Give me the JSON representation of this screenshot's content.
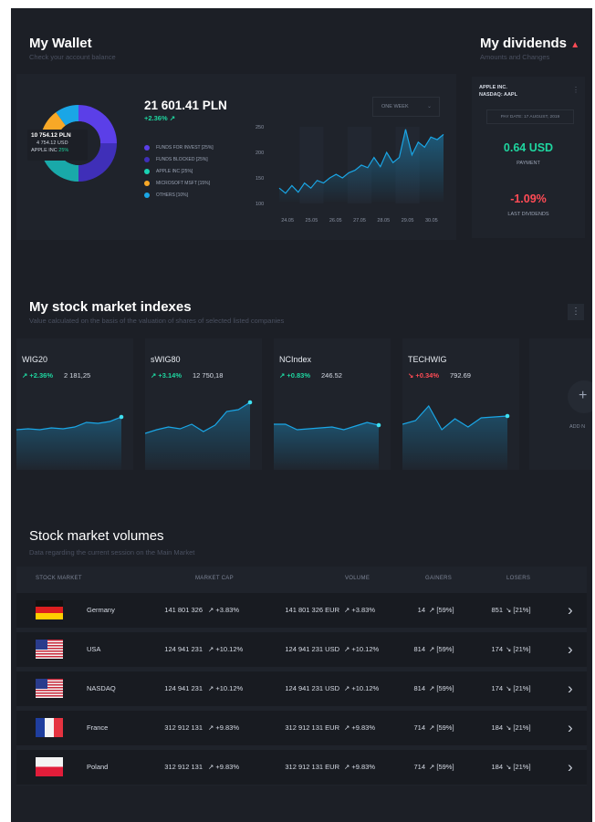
{
  "wallet": {
    "title": "My Wallet",
    "subtitle": "Check your account balance",
    "balance": "21 601.41 PLN",
    "change": "+2.36% ↗",
    "donut_center": {
      "line1": "10 754.12 PLN",
      "line2": "4 754.12 USD",
      "line3": "APPLE INC",
      "line3_pct": "25%"
    },
    "legend": [
      {
        "label": "FUNDS FOR INVEST [25%]",
        "color": "#5b3fe8"
      },
      {
        "label": "FUNDS BLOCKED [25%]",
        "color": "#3f2fb8"
      },
      {
        "label": "APPLE INC [25%]",
        "color": "#19d3b4"
      },
      {
        "label": "MICROSOFT MSFT [15%]",
        "color": "#f7a827"
      },
      {
        "label": "OTHERS [10%]",
        "color": "#1aa6e6"
      }
    ],
    "donut_segments": [
      {
        "name": "funds-for-invest",
        "value": 25,
        "color": "#5b3fe8"
      },
      {
        "name": "funds-blocked",
        "value": 25,
        "color": "#3f2fb8"
      },
      {
        "name": "apple",
        "value": 25,
        "color": "#19a9a9"
      },
      {
        "name": "microsoft",
        "value": 15,
        "color": "#f7a827"
      },
      {
        "name": "others",
        "value": 10,
        "color": "#1aa6e6"
      }
    ],
    "period": "ONE WEEK",
    "chart_data": {
      "type": "area",
      "x": [
        "24.05",
        "25.05",
        "26.05",
        "27.05",
        "28.05",
        "29.05",
        "30.05"
      ],
      "y_ticks": [
        100,
        150,
        200,
        250
      ],
      "ylim": [
        100,
        250
      ],
      "values": [
        130,
        120,
        135,
        122,
        140,
        130,
        145,
        140,
        150,
        157,
        150,
        160,
        165,
        175,
        170,
        190,
        172,
        200,
        180,
        190,
        245,
        195,
        220,
        210,
        230,
        225,
        235
      ]
    }
  },
  "dividends": {
    "title": "My dividends",
    "subtitle": "Amounts and Changes",
    "company": "APPLE INC.",
    "ticker": "NASDAQ: AAPL",
    "pay_date": "PAY DATE: 17 AUGUST, 2019",
    "payment_value": "0.64 USD",
    "payment_label": "PAYMENT",
    "last_value": "-1.09%",
    "last_label": "LAST DIVIDENDS"
  },
  "indexes": {
    "title": "My stock market indexes",
    "subtitle": "Value calculated on the basis of the valuation of shares of selected listed companies",
    "add_label": "ADD N",
    "cards": [
      {
        "name": "WIG20",
        "change": "↗ +2.36%",
        "direction": "up",
        "value": "2 181,25",
        "points": [
          50,
          49,
          50,
          48,
          49,
          47,
          42,
          43,
          41,
          36
        ]
      },
      {
        "name": "sWIG80",
        "change": "↗ +3.14%",
        "direction": "up",
        "value": "12 750,18",
        "points": [
          54,
          50,
          47,
          49,
          44,
          52,
          45,
          30,
          28,
          20
        ]
      },
      {
        "name": "NCIndex",
        "change": "↗ +0.83%",
        "direction": "up",
        "value": "246.52",
        "points": [
          44,
          44,
          50,
          49,
          48,
          47,
          50,
          46,
          42,
          45
        ]
      },
      {
        "name": "TECHWIG",
        "change": "↘ +0.34%",
        "direction": "down",
        "value": "792.69",
        "points": [
          44,
          40,
          24,
          50,
          38,
          47,
          37,
          36,
          35
        ]
      }
    ]
  },
  "volumes": {
    "title": "Stock market volumes",
    "subtitle": "Data regarding the current session on the Main Market",
    "headers": {
      "market": "STOCK MARKET",
      "cap": "MARKET CAP",
      "volume": "VOLUME",
      "gainers": "GAINERS",
      "losers": "LOSERS"
    },
    "rows": [
      {
        "market": "Germany",
        "flag": "germany",
        "cap": "141 801 326",
        "cap_chg": "↗ +3.83%",
        "volume": "141 801 326 EUR",
        "vol_chg": "↗ +3.83%",
        "gainers": "14",
        "gainers_pct": "↗ [59%]",
        "losers": "851",
        "losers_pct": "↘ [21%]"
      },
      {
        "market": "USA",
        "flag": "usa",
        "cap": "124 941 231",
        "cap_chg": "↗ +10.12%",
        "volume": "124 941 231 USD",
        "vol_chg": "↗ +10.12%",
        "gainers": "814",
        "gainers_pct": "↗ [59%]",
        "losers": "174",
        "losers_pct": "↘ [21%]"
      },
      {
        "market": "NASDAQ",
        "flag": "usa",
        "cap": "124 941 231",
        "cap_chg": "↗ +10.12%",
        "volume": "124 941 231 USD",
        "vol_chg": "↗ +10.12%",
        "gainers": "814",
        "gainers_pct": "↗ [59%]",
        "losers": "174",
        "losers_pct": "↘ [21%]"
      },
      {
        "market": "France",
        "flag": "france",
        "cap": "312 912 131",
        "cap_chg": "↗ +9.83%",
        "volume": "312 912 131 EUR",
        "vol_chg": "↗ +9.83%",
        "gainers": "714",
        "gainers_pct": "↗ [59%]",
        "losers": "184",
        "losers_pct": "↘ [21%]"
      },
      {
        "market": "Poland",
        "flag": "poland",
        "cap": "312 912 131",
        "cap_chg": "↗ +9.83%",
        "volume": "312 912 131 EUR",
        "vol_chg": "↗ +9.83%",
        "gainers": "714",
        "gainers_pct": "↗ [59%]",
        "losers": "184",
        "losers_pct": "↘ [21%]"
      }
    ]
  },
  "colors": {
    "up": "#1fd6a0",
    "down": "#ff4b55",
    "line": "#1aa6e6",
    "bg": "#1c1f26"
  }
}
